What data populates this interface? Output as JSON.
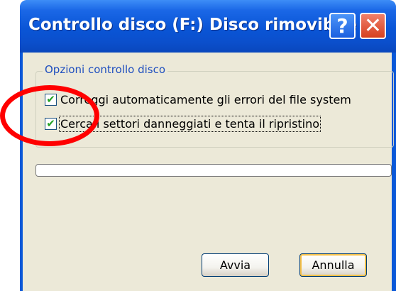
{
  "window": {
    "title": "Controllo disco (F:) Disco rimovibile",
    "help_glyph": "?",
    "close_glyph": "✕"
  },
  "group": {
    "legend": "Opzioni controllo disco",
    "options": [
      {
        "label": "Correggi automaticamente gli errori del file system",
        "checked": true
      },
      {
        "label": "Cerca i settori danneggiati e tenta il ripristino",
        "checked": true
      }
    ]
  },
  "progress": {
    "value": 0
  },
  "buttons": {
    "start_label": "Avvia",
    "cancel_label": "Annulla"
  },
  "checkmark_glyph": "✔",
  "colors": {
    "titlebar": "#0a55d6",
    "dialog_background": "#ece9d8",
    "group_legend": "#1f4fbf",
    "close_button": "#d6401f",
    "annotation_circle": "#ff0000"
  }
}
